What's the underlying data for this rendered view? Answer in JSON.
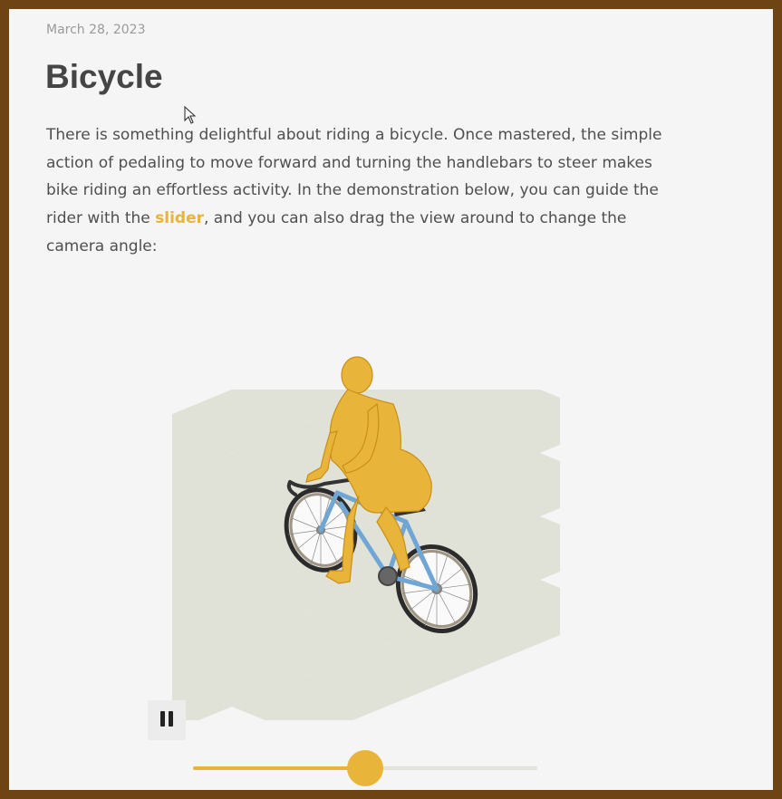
{
  "post": {
    "date": "March 28, 2023",
    "title": "Bicycle",
    "intro_before_link": "There is something delightful about riding a bicycle. Once mastered, the simple action of pedaling to move forward and turning the handlebars to steer makes bike riding an effortless activity. In the demonstration below, you can guide the rider with the ",
    "intro_link": "slider",
    "intro_after_link": ", and you can also drag the view around to change the camera angle:"
  },
  "demo": {
    "slider_fraction": 0.5,
    "accent_color": "#e8b53a",
    "rider_color": "#e8b53a",
    "frame_color": "#6fa6d6",
    "floor_tile_color": "#e0e2d8",
    "pause_icon": "pause-icon"
  }
}
